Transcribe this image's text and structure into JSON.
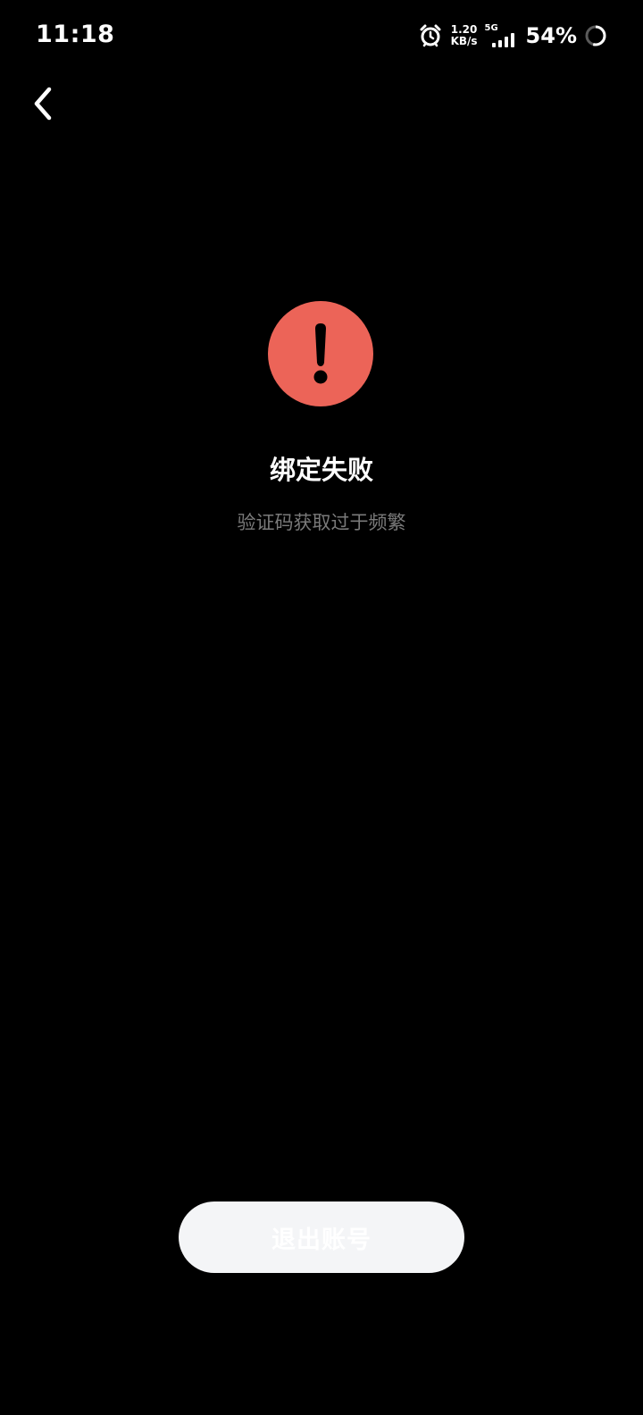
{
  "status_bar": {
    "time": "11:18",
    "net_speed_value": "1.20",
    "net_speed_unit": "KB/s",
    "network_type": "5G",
    "battery": "54%"
  },
  "nav": {
    "back_icon": "chevron-left-icon"
  },
  "result": {
    "icon": "exclamation-circle-icon",
    "icon_color": "#ec6458",
    "title": "绑定失败",
    "message": "验证码获取过于频繁"
  },
  "actions": {
    "logout_label": "退出账号"
  }
}
